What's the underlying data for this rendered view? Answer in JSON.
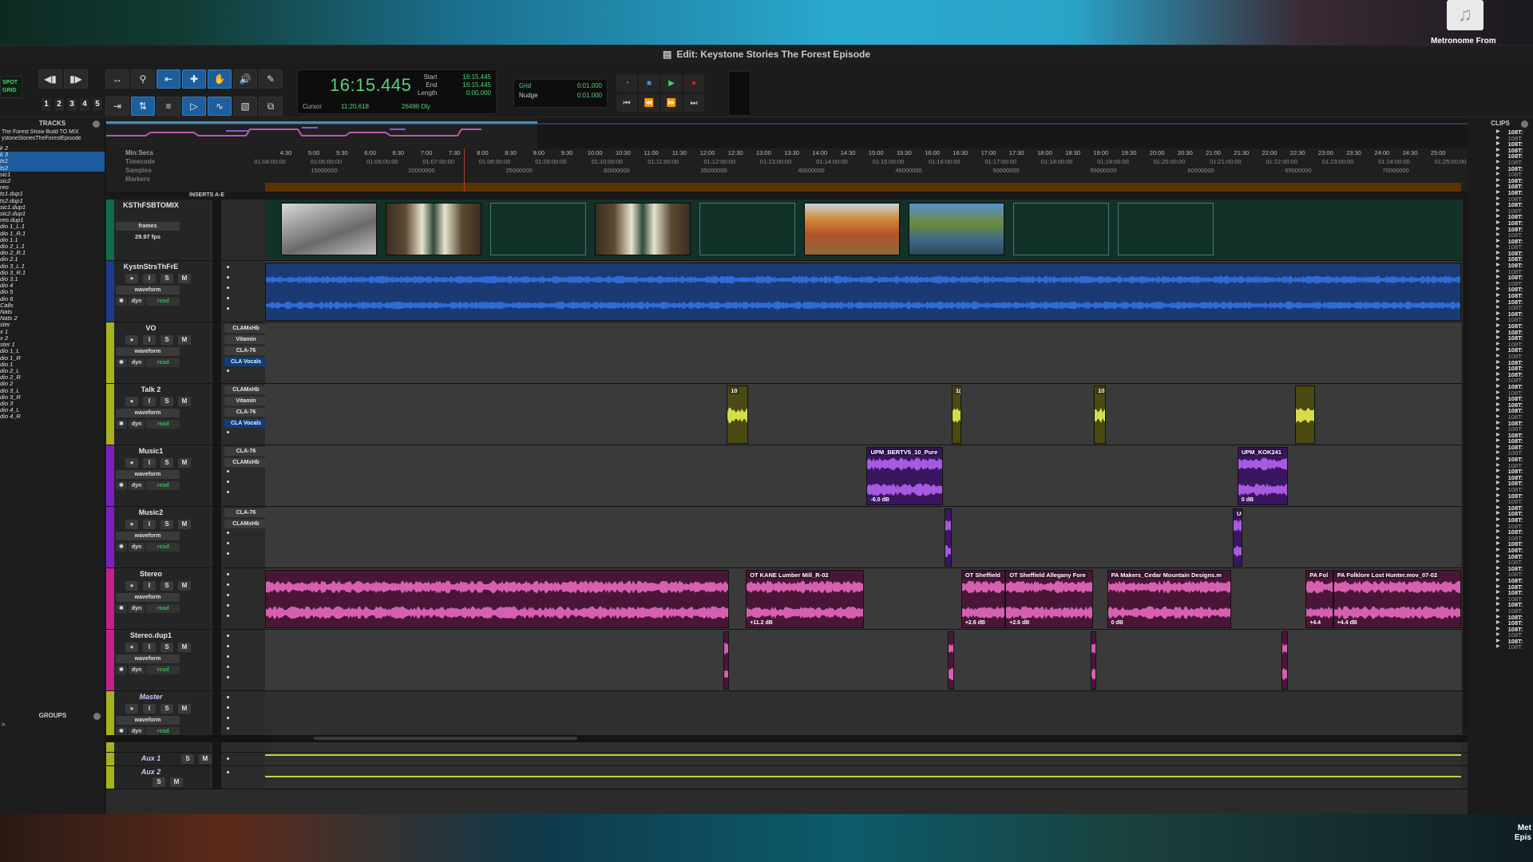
{
  "desktop": {
    "dock_app_label": "Metronome From",
    "corner_label_1": "Met",
    "corner_label_2": "Epis"
  },
  "window": {
    "title": "Edit: Keystone Stories The Forest Episode"
  },
  "toolbar": {
    "mode_spot": "SPOT",
    "mode_grid": "GRID",
    "zoom_presets": [
      "1",
      "2",
      "3",
      "4",
      "5"
    ],
    "counter": {
      "main": "16:15.445",
      "labels": [
        "Start",
        "End",
        "Length"
      ],
      "values": [
        "16:15.445",
        "16:15.445",
        "0:00.000"
      ],
      "cursor_label": "Cursor",
      "cursor_value": "11:20.618",
      "delay_value": "26496",
      "dly_label": "Dly"
    },
    "grid": {
      "label": "Grid",
      "value": "0:01.000"
    },
    "nudge": {
      "label": "Nudge",
      "value": "0:01.000"
    }
  },
  "tracks_panel": {
    "title": "TRACKS",
    "session_line1": "The Forest Show Build TO MIX",
    "session_line2": "ystoneStoriesTheForestEpisode",
    "items": [
      {
        "label": "k 2",
        "selected": false
      },
      {
        "label": "k 3",
        "selected": true
      },
      {
        "label": "ts1",
        "selected": true
      },
      {
        "label": "ts2",
        "selected": true
      },
      {
        "label": "sic1",
        "selected": false
      },
      {
        "label": "sic2",
        "selected": false
      },
      {
        "label": "reo",
        "selected": false
      },
      {
        "label": "ts1.dup1",
        "selected": false
      },
      {
        "label": "ts2.dup1",
        "selected": false
      },
      {
        "label": "sic1.dup1",
        "selected": false
      },
      {
        "label": "sic2.dup1",
        "selected": false
      },
      {
        "label": "reo.dup1",
        "selected": false
      },
      {
        "label": "dio 1_L.1",
        "selected": false
      },
      {
        "label": "dio 1_R.1",
        "selected": false
      },
      {
        "label": "dio 1.1",
        "selected": false
      },
      {
        "label": "dio 2_L.1",
        "selected": false
      },
      {
        "label": "dio 2_R.1",
        "selected": false
      },
      {
        "label": "dio 2.1",
        "selected": false
      },
      {
        "label": "dio 3_L.1",
        "selected": false
      },
      {
        "label": "dio 3_R.1",
        "selected": false
      },
      {
        "label": "dio 3.1",
        "selected": false
      },
      {
        "label": "dio 4",
        "selected": false
      },
      {
        "label": "dio 5",
        "selected": false
      },
      {
        "label": "dio 6",
        "selected": false
      },
      {
        "label": " Calls",
        "selected": false
      },
      {
        "label": " Nats",
        "selected": false
      },
      {
        "label": " Nats 2",
        "selected": false
      },
      {
        "label": "ster",
        "selected": false
      },
      {
        "label": "x 1",
        "selected": false
      },
      {
        "label": "x 2",
        "selected": false
      },
      {
        "label": "ster 1",
        "selected": false
      },
      {
        "label": "dio 1_L",
        "selected": false
      },
      {
        "label": "dio 1_R",
        "selected": false
      },
      {
        "label": "dio 1",
        "selected": false
      },
      {
        "label": "dio 2_L",
        "selected": false
      },
      {
        "label": "dio 2_R",
        "selected": false
      },
      {
        "label": "dio 2",
        "selected": false
      },
      {
        "label": "dio 3_L",
        "selected": false
      },
      {
        "label": "dio 3_R",
        "selected": false
      },
      {
        "label": "dio 3",
        "selected": false
      },
      {
        "label": "dio 4_L",
        "selected": false
      },
      {
        "label": "dio 4_R",
        "selected": false
      }
    ],
    "groups_title": "GROUPS",
    "groups_item": ">"
  },
  "rulers": {
    "names": [
      "Min:Secs",
      "Timecode",
      "Samples",
      "Markers"
    ],
    "minsecs": [
      "4:30",
      "5:00",
      "5:30",
      "6:00",
      "6:30",
      "7:00",
      "7:30",
      "8:00",
      "8:30",
      "9:00",
      "9:30",
      "10:00",
      "10:30",
      "11:00",
      "11:30",
      "12:00",
      "12:30",
      "13:00",
      "13:30",
      "14:00",
      "14:30",
      "15:00",
      "15:30",
      "16:00",
      "16:30",
      "17:00",
      "17:30",
      "18:00",
      "18:30",
      "19:00",
      "19:30",
      "20:00",
      "20:30",
      "21:00",
      "21:30",
      "22:00",
      "22:30",
      "23:00",
      "23:30",
      "24:00",
      "24:30",
      "25:00"
    ],
    "timecode": [
      "01:04:00:00",
      "01:05:00:00",
      "01:06:00:00",
      "01:07:00:00",
      "01:08:00:00",
      "01:09:00:00",
      "01:10:00:00",
      "01:11:00:00",
      "01:12:00:00",
      "01:13:00:00",
      "01:14:00:00",
      "01:15:00:00",
      "01:16:00:00",
      "01:17:00:00",
      "01:18:00:00",
      "01:19:00:00",
      "01:20:00:00",
      "01:21:00:00",
      "01:22:00:00",
      "01:23:00:00",
      "01:24:00:00",
      "01:25:00:00"
    ],
    "samples": [
      "15000000",
      "20000000",
      "25000000",
      "30000000",
      "35000000",
      "40000000",
      "45000000",
      "50000000",
      "55000000",
      "60000000",
      "65000000",
      "70000000"
    ],
    "insert_header": "INSERTS A-E"
  },
  "tracks": [
    {
      "name": "KSThFSBTOMIX",
      "type": "video",
      "color": "#0f6b4f",
      "rate_label": "frames",
      "fps": "29.97 fps",
      "thumbs": [
        "photo-bw-group",
        "man-interview",
        "empty",
        "man-interview",
        "empty",
        "autumn-forest",
        "lake-reflection",
        "empty",
        "empty"
      ]
    },
    {
      "name": "KystnStrsThFrE",
      "type": "audio",
      "color": "#1c3d8f",
      "wf": "waveform",
      "dyn": "dyn",
      "auto": "read",
      "inserts": [],
      "clips": [
        {
          "start": 0,
          "end": 1,
          "label": "",
          "color": "#2f6bd6",
          "bg": "#1b3a74"
        }
      ]
    },
    {
      "name": "VO",
      "type": "audio",
      "color": "#a8b21c",
      "wf": "waveform",
      "dyn": "dyn",
      "auto": "read",
      "inserts": [
        "CLAMxHb",
        "Vitamin",
        "CLA-76",
        "CLA Vocals"
      ],
      "clips": []
    },
    {
      "name": "Talk 2",
      "type": "audio",
      "color": "#a8b21c",
      "wf": "waveform",
      "dyn": "dyn",
      "auto": "read",
      "inserts": [
        "CLAMxHb",
        "Vitamin",
        "CLA-76",
        "CLA Vocals"
      ],
      "clips": [
        {
          "start": 0.386,
          "end": 0.404,
          "label": "10",
          "color": "#d6dd4a",
          "bg": "#4a4a12"
        },
        {
          "start": 0.574,
          "end": 0.582,
          "label": "1(",
          "color": "#d6dd4a",
          "bg": "#4a4a12"
        },
        {
          "start": 0.693,
          "end": 0.703,
          "label": "10",
          "color": "#d6dd4a",
          "bg": "#4a4a12"
        },
        {
          "start": 0.861,
          "end": 0.878,
          "label": "",
          "color": "#d6dd4a",
          "bg": "#4a4a12"
        }
      ]
    },
    {
      "name": "Music1",
      "type": "audio",
      "color": "#7a1fc4",
      "wf": "waveform",
      "dyn": "dyn",
      "auto": "read",
      "inserts": [
        "CLA-76",
        "CLAMxHb"
      ],
      "clips": [
        {
          "start": 0.503,
          "end": 0.567,
          "label": "UPM_BERTV5_10_Pure",
          "gain": "-6.0 dB",
          "color": "#a65ae0",
          "bg": "#3a1660"
        },
        {
          "start": 0.813,
          "end": 0.855,
          "label": "UPM_KOK241",
          "gain": "0 dB",
          "color": "#a65ae0",
          "bg": "#3a1660"
        }
      ]
    },
    {
      "name": "Music2",
      "type": "audio",
      "color": "#7a1fc4",
      "wf": "waveform",
      "dyn": "dyn",
      "auto": "read",
      "inserts": [
        "CLA-76",
        "CLAMxHb"
      ],
      "clips": [
        {
          "start": 0.568,
          "end": 0.574,
          "label": "",
          "color": "#a65ae0",
          "bg": "#3a1660"
        },
        {
          "start": 0.809,
          "end": 0.817,
          "label": "UI",
          "color": "#a65ae0",
          "bg": "#3a1660"
        }
      ]
    },
    {
      "name": "Stereo",
      "type": "audio",
      "color": "#c41f8f",
      "wf": "waveform",
      "dyn": "dyn",
      "auto": "read",
      "inserts": [],
      "clips": [
        {
          "start": 0.0,
          "end": 0.388,
          "label": "",
          "color": "#d660b0",
          "bg": "#4a1638"
        },
        {
          "start": 0.402,
          "end": 0.501,
          "label": "OT KANE Lumber Mill_R-02",
          "gain": "+11.2 dB",
          "color": "#d660b0",
          "bg": "#4a1638"
        },
        {
          "start": 0.582,
          "end": 0.619,
          "label": "OT Sheffield",
          "gain": "+2.6 dB",
          "color": "#d660b0",
          "bg": "#4a1638"
        },
        {
          "start": 0.619,
          "end": 0.692,
          "label": "OT Sheffield Allegany Fore",
          "gain": "+2.6 dB",
          "color": "#d660b0",
          "bg": "#4a1638"
        },
        {
          "start": 0.704,
          "end": 0.808,
          "label": "PA Makers_Cedar Mountain Designs.m",
          "gain": "0 dB",
          "color": "#d660b0",
          "bg": "#4a1638"
        },
        {
          "start": 0.87,
          "end": 0.893,
          "label": "PA Fol",
          "gain": "+4.4",
          "color": "#d660b0",
          "bg": "#4a1638"
        },
        {
          "start": 0.893,
          "end": 1.0,
          "label": "PA Folklore Lost Hunter.mov_07-02",
          "gain": "+4.4 dB",
          "color": "#d660b0",
          "bg": "#4a1638"
        }
      ]
    },
    {
      "name": "Stereo.dup1",
      "type": "audio",
      "color": "#c41f8f",
      "wf": "waveform",
      "dyn": "dyn",
      "auto": "read",
      "inserts": [],
      "clips": [
        {
          "start": 0.383,
          "end": 0.388,
          "label": "",
          "color": "#d660b0",
          "bg": "#4a1638"
        },
        {
          "start": 0.571,
          "end": 0.576,
          "label": "",
          "color": "#d660b0",
          "bg": "#4a1638"
        },
        {
          "start": 0.69,
          "end": 0.695,
          "label": "",
          "color": "#d660b0",
          "bg": "#4a1638"
        },
        {
          "start": 0.85,
          "end": 0.855,
          "label": "",
          "color": "#d660b0",
          "bg": "#4a1638"
        }
      ]
    },
    {
      "name": "Master",
      "type": "master",
      "color": "#a8b21c",
      "wf": "waveform",
      "dyn": "dyn",
      "auto": "read",
      "inserts": [],
      "clips": []
    },
    {
      "name": "Aux 1",
      "type": "aux",
      "color": "#a8b21c",
      "inserts": [],
      "clips": []
    },
    {
      "name": "Aux 2",
      "type": "aux",
      "color": "#a8b21c",
      "inserts": [],
      "clips": []
    }
  ],
  "ism": {
    "input": "I",
    "solo": "S",
    "mute": "M"
  },
  "clips_panel": {
    "title": "CLIPS",
    "item_label": "108T:",
    "count": 86
  }
}
